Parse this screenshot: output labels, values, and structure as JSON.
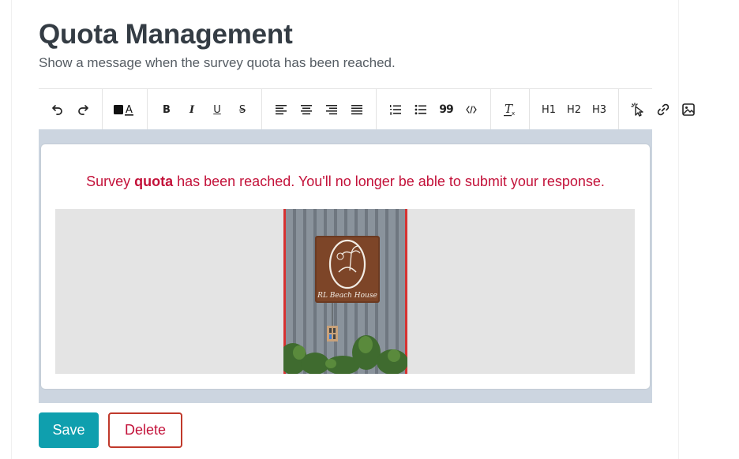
{
  "header": {
    "title": "Quota Management",
    "subtitle": "Show a message when the survey quota has been reached."
  },
  "toolbar": {
    "groups": [
      [
        "undo-icon",
        "redo-icon"
      ],
      [
        "text-color-icon"
      ],
      [
        "bold-icon",
        "italic-icon",
        "underline-icon",
        "strikethrough-icon"
      ],
      [
        "align-left-icon",
        "align-center-icon",
        "align-right-icon",
        "align-justify-icon"
      ],
      [
        "ordered-list-icon",
        "bullet-list-icon",
        "blockquote-icon",
        "code-icon"
      ],
      [
        "clear-format-icon"
      ],
      [
        "heading-1-icon",
        "heading-2-icon",
        "heading-3-icon"
      ],
      [
        "pointer-icon",
        "link-icon",
        "image-icon"
      ]
    ],
    "labels": {
      "bold": "B",
      "italic": "I",
      "underline": "U",
      "strike": "S",
      "quote": "99",
      "h1": "H1",
      "h2": "H2",
      "h3": "H3"
    }
  },
  "editor": {
    "message_before": "Survey ",
    "message_bold": "quota",
    "message_after": " has been reached. You'll no longer be able to submit your response.",
    "message_color": "#c3123a",
    "image_sign_text": "RL Beach House"
  },
  "actions": {
    "save_label": "Save",
    "delete_label": "Delete"
  },
  "colors": {
    "accent": "#0f9fae",
    "danger": "#c3123a",
    "editor_bg": "#ccd5e0"
  }
}
